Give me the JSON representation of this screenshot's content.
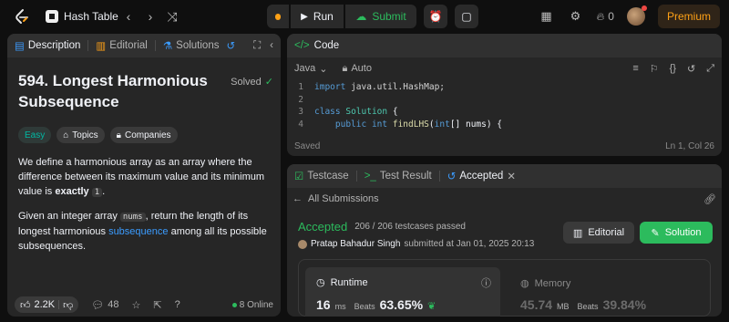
{
  "topbar": {
    "problem_list": "Hash Table",
    "run": "Run",
    "submit": "Submit",
    "streak": "0",
    "premium": "Premium"
  },
  "description": {
    "tabs": [
      "Description",
      "Editorial",
      "Solutions"
    ],
    "title": "594. Longest Harmonious Subsequence",
    "solved": "Solved",
    "difficulty": "Easy",
    "topics": "Topics",
    "companies": "Companies",
    "p1_a": "We define a harmonious array as an array where the difference between its maximum value and its minimum value is ",
    "p1_b": "exactly",
    "p1_c": "1",
    "p1_d": ".",
    "p2_a": "Given an integer array ",
    "p2_b": "nums",
    "p2_c": ", return the length of its longest harmonious ",
    "p2_d": "subsequence",
    "p2_e": " among all its possible subsequences.",
    "likes": "2.2K",
    "comments": "48",
    "online": "8 Online"
  },
  "code": {
    "tab": "Code",
    "language": "Java",
    "mode": "Auto",
    "lines": [
      {
        "n": "1",
        "text": "import java.util.HashMap;"
      },
      {
        "n": "2",
        "text": ""
      },
      {
        "n": "3",
        "text": "class Solution {"
      },
      {
        "n": "4",
        "text": "    public int findLHS(int[] nums) {"
      }
    ],
    "saved": "Saved",
    "cursor": "Ln 1, Col 26"
  },
  "result": {
    "tabs": [
      "Testcase",
      "Test Result",
      "Accepted"
    ],
    "back": "All Submissions",
    "status": "Accepted",
    "passed": "206 / 206 testcases passed",
    "submitter": "Pratap Bahadur Singh",
    "submitted_at": "submitted at Jan 01, 2025 20:13",
    "editorial_btn": "Editorial",
    "solution_btn": "Solution",
    "runtime_label": "Runtime",
    "runtime_value": "16",
    "runtime_unit": "ms",
    "runtime_beats_label": "Beats",
    "runtime_beats": "63.65%",
    "memory_label": "Memory",
    "memory_value": "45.74",
    "memory_unit": "MB",
    "memory_beats_label": "Beats",
    "memory_beats": "39.84%"
  },
  "colors": {
    "accent_green": "#2cbb5d",
    "premium_orange": "#ffa116",
    "easy_teal": "#00b8a3",
    "link_blue": "#3b9cff"
  }
}
